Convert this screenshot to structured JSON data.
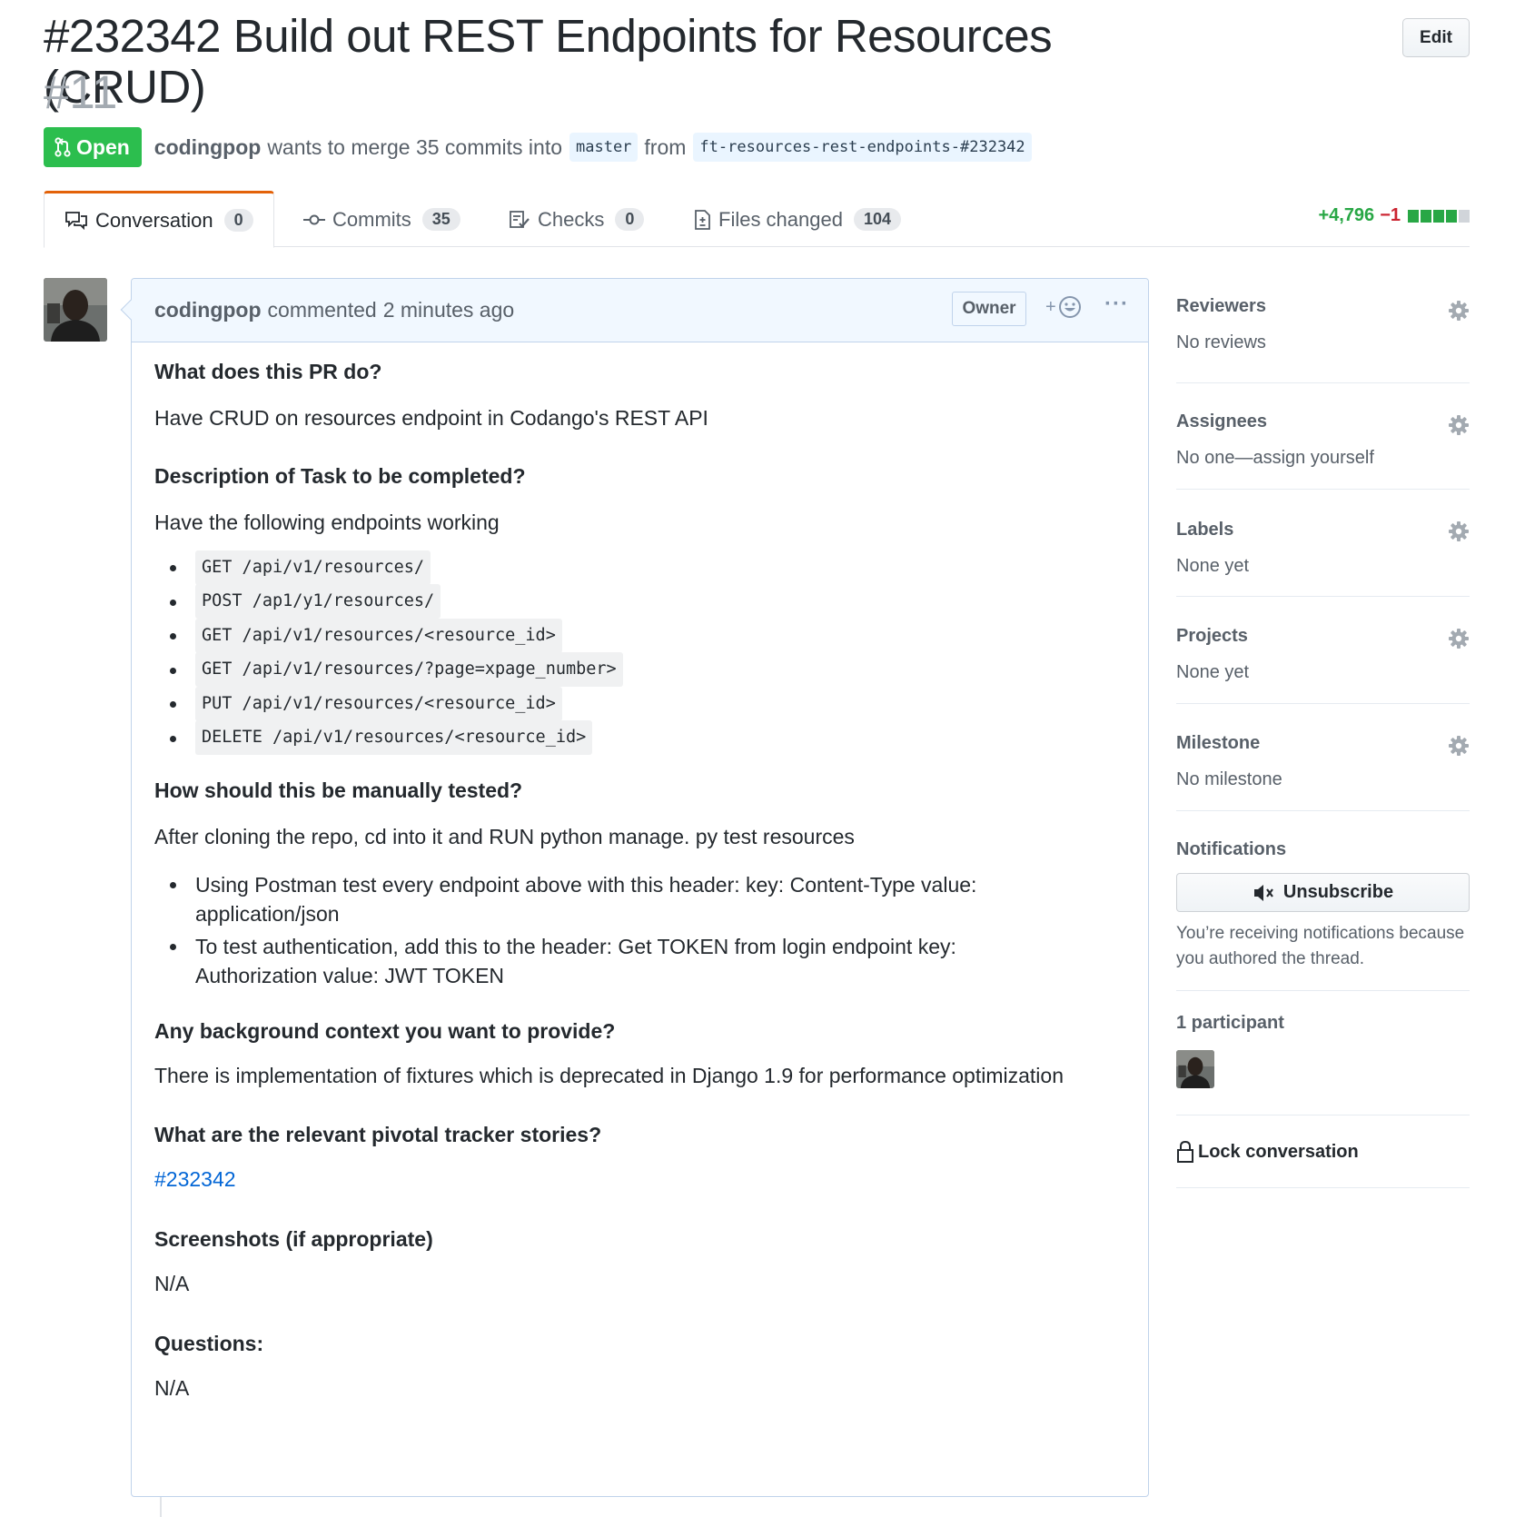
{
  "header": {
    "title": "#232342 Build out REST Endpoints for Resources (CRUD)",
    "number": "#11",
    "edit_label": "Edit",
    "state": "Open",
    "author": "codingpop",
    "merge_text": "wants to merge 35 commits into",
    "base_branch": "master",
    "from_text": "from",
    "head_branch": "ft-resources-rest-endpoints-#232342"
  },
  "tabs": [
    {
      "label": "Conversation",
      "count": "0",
      "icon": "comment-discussion-icon"
    },
    {
      "label": "Commits",
      "count": "35",
      "icon": "git-commit-icon"
    },
    {
      "label": "Checks",
      "count": "0",
      "icon": "checklist-icon"
    },
    {
      "label": "Files changed",
      "count": "104",
      "icon": "diff-icon"
    }
  ],
  "diffstat": {
    "additions": "+4,796",
    "deletions": "−1",
    "add_color": "#28a745",
    "del_color": "#cb2431",
    "neutral_color": "#d1d5da",
    "blocks": [
      "add",
      "add",
      "add",
      "add",
      "neutral"
    ]
  },
  "comment": {
    "author": "codingpop",
    "action": "commented",
    "time": "2 minutes ago",
    "badge": "Owner",
    "reaction_plus": "+",
    "more": "···",
    "q1": "What does this PR do?",
    "a1": "Have CRUD on resources endpoint in Codango's REST API",
    "q2": "Description of Task to be completed?",
    "a2": "Have the following endpoints working",
    "endpoints": [
      "GET /api/v1/resources/",
      "POST /ap1/y1/resources/",
      "GET /api/v1/resources/<resource_id>",
      "GET /api/v1/resources/?page=xpage_number>",
      "PUT /api/v1/resources/<resource_id>",
      "DELETE /api/v1/resources/<resource_id>"
    ],
    "q3": "How should this be manually tested?",
    "a3": "After cloning the repo, cd into it and RUN python manage. py test resources",
    "test_steps": [
      "Using Postman test every endpoint above with this header: key: Content-Type value: application/json",
      "To test authentication, add this to the header: Get TOKEN from login endpoint key: Authorization value: JWT TOKEN"
    ],
    "q4": "Any background context you want to provide?",
    "a4": "There is implementation of fixtures which is deprecated in Django 1.9 for performance optimization",
    "q5": "What are the relevant pivotal tracker stories?",
    "a5_link": "#232342",
    "q6": "Screenshots (if appropriate)",
    "a6": "N/A",
    "q7": "Questions:",
    "a7": "N/A"
  },
  "sidebar": {
    "reviewers": {
      "heading": "Reviewers",
      "value": "No reviews"
    },
    "assignees": {
      "heading": "Assignees",
      "value": "No one—assign yourself"
    },
    "labels": {
      "heading": "Labels",
      "value": "None yet"
    },
    "projects": {
      "heading": "Projects",
      "value": "None yet"
    },
    "milestone": {
      "heading": "Milestone",
      "value": "No milestone"
    },
    "notifications": {
      "heading": "Notifications",
      "button": "Unsubscribe",
      "note": "You’re receiving notifications because you authored the thread."
    },
    "participants": {
      "heading": "1 participant"
    },
    "lock": "Lock conversation"
  },
  "colors": {
    "open_green": "#2cbe4e",
    "link_blue": "#0366d6",
    "tab_accent": "#e36209"
  }
}
